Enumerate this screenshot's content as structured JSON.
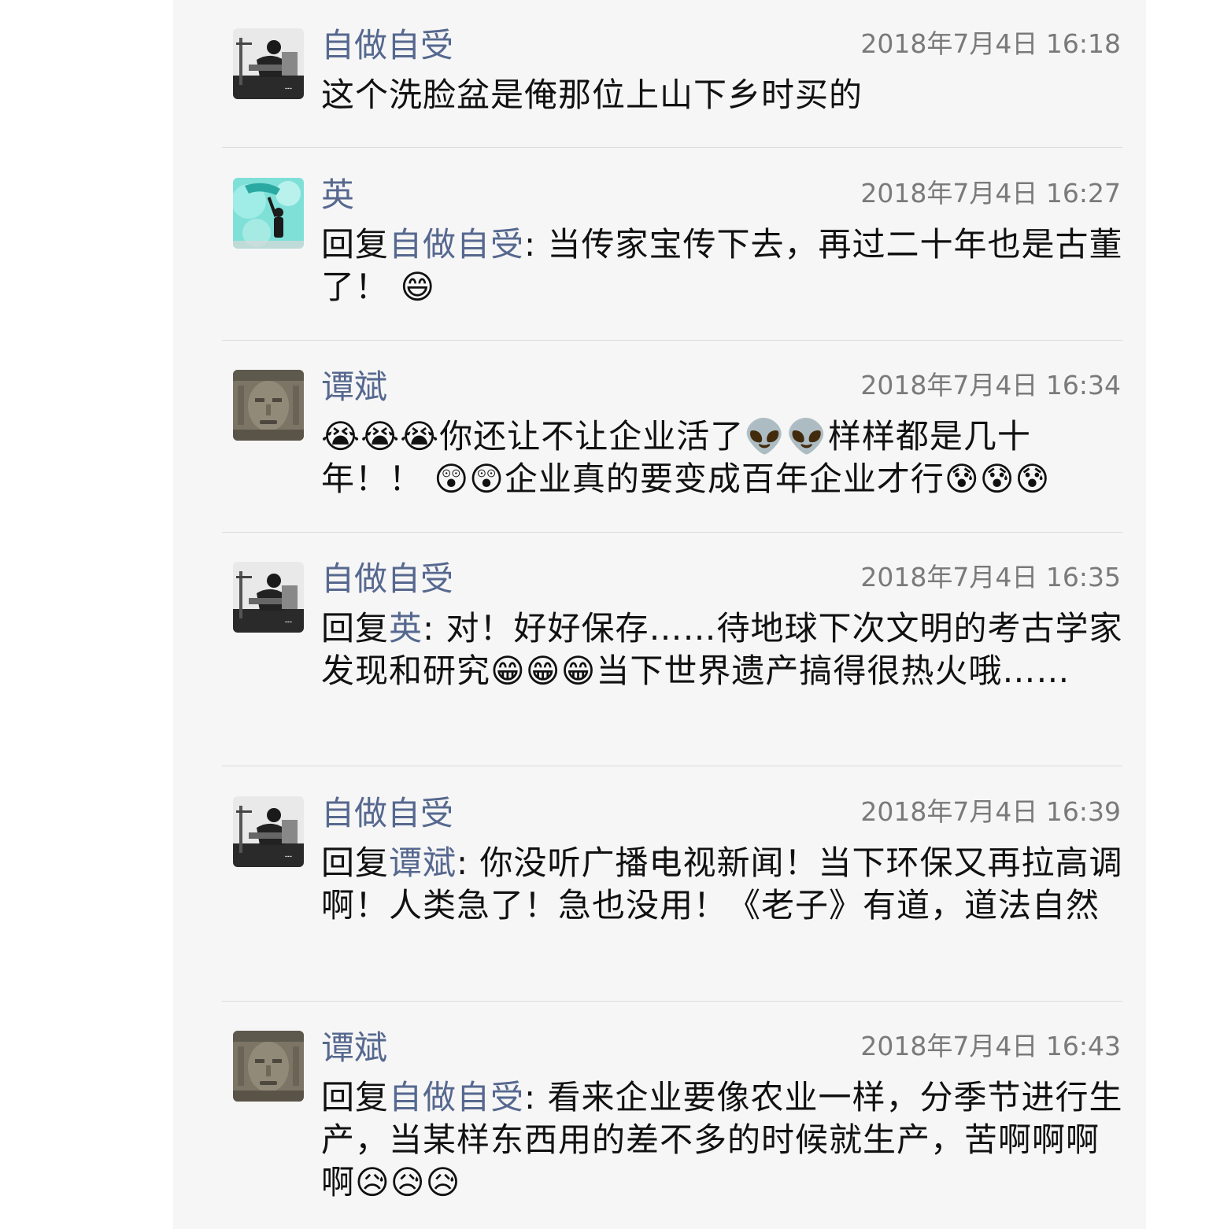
{
  "comments": [
    {
      "author": "自做自受",
      "time": "2018年7月4日 16:18",
      "reply_prefix": "",
      "reply_to": "",
      "reply_sep": "",
      "text": "这个洗脸盆是俺那位上山下乡时买的",
      "avatar_icon": "workshop-photo-avatar"
    },
    {
      "author": "英",
      "time": "2018年7月4日 16:27",
      "reply_prefix": "回复",
      "reply_to": "自做自受",
      "reply_sep": ": ",
      "text": "当传家宝传下去，再过二十年也是古董了！ 😄",
      "avatar_icon": "teal-portrait-avatar"
    },
    {
      "author": "谭斌",
      "time": "2018年7月4日 16:34",
      "reply_prefix": "",
      "reply_to": "",
      "reply_sep": "",
      "text": "😭😭😭你还让不让企业活了👽👽样样都是几十年！！ 😲😲企业真的要变成百年企业才行😰😰😰",
      "avatar_icon": "stone-face-avatar"
    },
    {
      "author": "自做自受",
      "time": "2018年7月4日 16:35",
      "reply_prefix": "回复",
      "reply_to": "英",
      "reply_sep": ": ",
      "text": "对！好好保存……待地球下次文明的考古学家发现和研究😁😁😁当下世界遗产搞得很热火哦……",
      "avatar_icon": "workshop-photo-avatar"
    },
    {
      "author": "自做自受",
      "time": "2018年7月4日 16:39",
      "reply_prefix": "回复",
      "reply_to": "谭斌",
      "reply_sep": ": ",
      "text": "你没听广播电视新闻！当下环保又再拉高调啊！人类急了！急也没用！《老子》有道，道法自然",
      "avatar_icon": "workshop-photo-avatar"
    },
    {
      "author": "谭斌",
      "time": "2018年7月4日 16:43",
      "reply_prefix": "回复",
      "reply_to": "自做自受",
      "reply_sep": ": ",
      "text": "看来企业要像农业一样，分季节进行生产，当某样东西用的差不多的时候就生产，苦啊啊啊啊😥😥😥",
      "avatar_icon": "stone-face-avatar"
    }
  ],
  "colors": {
    "author": "#56688f",
    "text": "#111111",
    "time": "#7a7a7a",
    "panel_bg": "#f6f6f6",
    "divider": "#dcdcdc"
  }
}
